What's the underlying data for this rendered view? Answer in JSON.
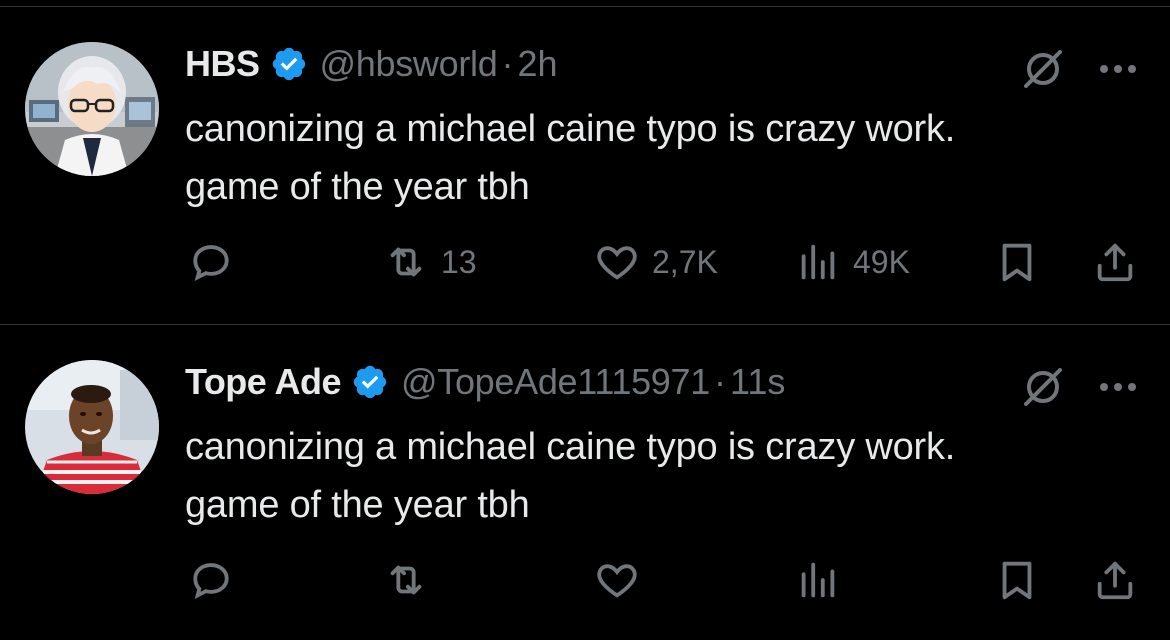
{
  "colors": {
    "background": "#000000",
    "text_primary": "#e7e9ea",
    "text_secondary": "#71767b",
    "verified_blue": "#1d9bf0",
    "divider": "#2f3336"
  },
  "tweets": [
    {
      "name": "HBS",
      "handle": "@hbsworld",
      "separator": "·",
      "time": "2h",
      "text_lines": [
        "canonizing a michael caine typo is crazy work.",
        "game of the year tbh"
      ],
      "avatar_icon": "anime-avatar",
      "actions": {
        "reply": "",
        "retweet": "13",
        "like": "2,7K",
        "views": "49K"
      }
    },
    {
      "name": "Tope Ade",
      "handle": "@TopeAde1115971",
      "separator": "·",
      "time": "11s",
      "text_lines": [
        "canonizing a michael caine typo is crazy work.",
        "game of the year tbh"
      ],
      "avatar_icon": "photo-avatar",
      "actions": {
        "reply": "",
        "retweet": "",
        "like": "",
        "views": ""
      }
    }
  ],
  "icons": {
    "verified": "verified-badge-icon",
    "grok": "grok-icon",
    "more": "more-dots-icon",
    "reply": "reply-icon",
    "retweet": "retweet-icon",
    "like": "heart-icon",
    "views": "views-icon",
    "bookmark": "bookmark-icon",
    "share": "share-icon"
  }
}
